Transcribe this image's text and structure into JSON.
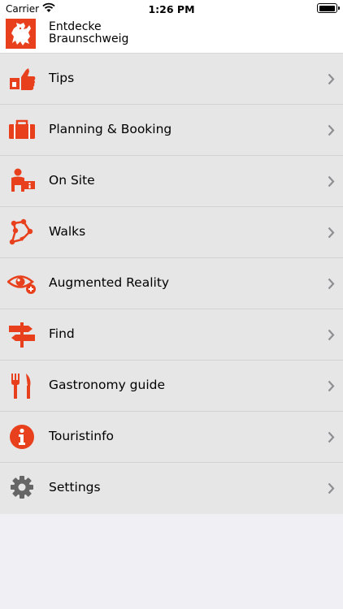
{
  "status_bar": {
    "carrier": "Carrier",
    "time": "1:26 PM"
  },
  "header": {
    "title_line1": "Entdecke",
    "title_line2": "Braunschweig"
  },
  "colors": {
    "accent": "#e8401c",
    "chevron": "#8e8e93",
    "row_bg": "#e6e6e6",
    "settings_icon": "#666666"
  },
  "menu": {
    "items": [
      {
        "label": "Tips",
        "icon": "thumbs-up-icon"
      },
      {
        "label": "Planning & Booking",
        "icon": "suitcase-icon"
      },
      {
        "label": "On Site",
        "icon": "info-person-icon"
      },
      {
        "label": "Walks",
        "icon": "route-icon"
      },
      {
        "label": "Augmented Reality",
        "icon": "eye-plus-icon"
      },
      {
        "label": "Find",
        "icon": "signpost-icon"
      },
      {
        "label": "Gastronomy guide",
        "icon": "fork-knife-icon"
      },
      {
        "label": "Touristinfo",
        "icon": "info-circle-icon"
      },
      {
        "label": "Settings",
        "icon": "gear-icon"
      }
    ]
  }
}
